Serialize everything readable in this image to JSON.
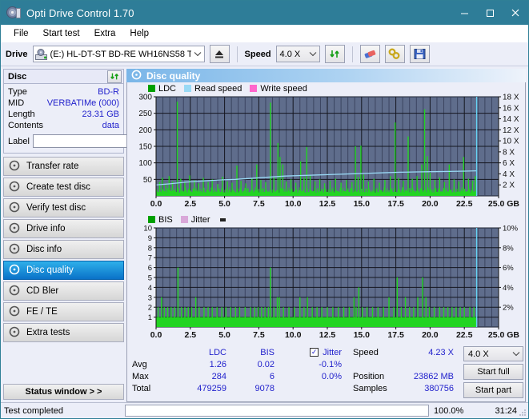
{
  "window": {
    "title": "Opti Drive Control 1.70",
    "icon": "disc-icon",
    "minimize": "─",
    "maximize": "□",
    "close": "✕"
  },
  "menu": {
    "items": [
      "File",
      "Start test",
      "Extra",
      "Help"
    ]
  },
  "toolbar": {
    "drive_label": "Drive",
    "drive_value": "(E:)  HL-DT-ST BD-RE  WH16NS58 TST4",
    "eject": "eject-icon",
    "speed_label": "Speed",
    "speed_value": "4.0 X",
    "refresh": "refresh-icon",
    "erase": "erase-icon",
    "tools": "tools-icon",
    "save": "save-icon"
  },
  "sidebar": {
    "disc_panel_title": "Disc",
    "disc_rows": [
      {
        "key": "Type",
        "value": "BD-R"
      },
      {
        "key": "MID",
        "value": "VERBATIMe (000)"
      },
      {
        "key": "Length",
        "value": "23.31 GB"
      },
      {
        "key": "Contents",
        "value": "data"
      }
    ],
    "label_key": "Label",
    "label_value": "",
    "nav": [
      {
        "label": "Transfer rate",
        "active": false
      },
      {
        "label": "Create test disc",
        "active": false
      },
      {
        "label": "Verify test disc",
        "active": false
      },
      {
        "label": "Drive info",
        "active": false
      },
      {
        "label": "Disc info",
        "active": false
      },
      {
        "label": "Disc quality",
        "active": true
      },
      {
        "label": "CD Bler",
        "active": false
      },
      {
        "label": "FE / TE",
        "active": false
      },
      {
        "label": "Extra tests",
        "active": false
      }
    ],
    "status_window_button": "Status window > >"
  },
  "content": {
    "header_title": "Disc quality",
    "header_icon": "disc-quality-icon"
  },
  "stats": {
    "col_headers": {
      "ldc": "LDC",
      "bis": "BIS",
      "jitter": "Jitter"
    },
    "jitter_checked": true,
    "rows": [
      {
        "label": "Avg",
        "ldc": "1.26",
        "bis": "0.02",
        "jitter": "-0.1%"
      },
      {
        "label": "Max",
        "ldc": "284",
        "bis": "6",
        "jitter": "0.0%"
      },
      {
        "label": "Total",
        "ldc": "479259",
        "bis": "9078",
        "jitter": ""
      }
    ],
    "speed_key": "Speed",
    "speed_value": "4.23 X",
    "position_key": "Position",
    "position_value": "23862 MB",
    "samples_key": "Samples",
    "samples_value": "380756",
    "speed_select": "4.0 X",
    "start_full": "Start full",
    "start_part": "Start part"
  },
  "statusbar": {
    "message": "Test completed",
    "percent_label": "100.0%",
    "percent_value": 100,
    "elapsed": "31:24"
  },
  "colors": {
    "titlebar": "#2e7d98",
    "accent_blue": "#2222cc",
    "plot_bg": "#5f6d8c",
    "grid": "#2b2f3d",
    "ldc_green": "#22d422",
    "read_speed": "#99d9f5",
    "write_speed": "#ff66cc",
    "jitter_pink": "#d9a8d9",
    "progress_green": "#00a824",
    "nav_active_top": "#2fb0ea",
    "nav_active_bottom": "#0a72c8"
  },
  "chart_data": [
    {
      "id": "ldc-chart",
      "type": "line",
      "title": "",
      "xlabel": "GB",
      "ylabel": "LDC",
      "xlim": [
        0,
        25
      ],
      "ylim": [
        0,
        300
      ],
      "y2lim": [
        0,
        18
      ],
      "y2label": "X",
      "xticks": [
        0.0,
        2.5,
        5.0,
        7.5,
        10.0,
        12.5,
        15.0,
        17.5,
        20.0,
        22.5,
        25.0
      ],
      "xticklabels": [
        "0.0",
        "2.5",
        "5.0",
        "7.5",
        "10.0",
        "12.5",
        "15.0",
        "17.5",
        "20.0",
        "22.5",
        "25.0 GB"
      ],
      "yticks": [
        50,
        100,
        150,
        200,
        250,
        300
      ],
      "y2ticks": [
        2,
        4,
        6,
        8,
        10,
        12,
        14,
        16,
        18
      ],
      "y2ticklabels": [
        "2 X",
        "4 X",
        "6 X",
        "8 X",
        "10 X",
        "12 X",
        "14 X",
        "16 X",
        "18 X"
      ],
      "grid": true,
      "legend": [
        "LDC",
        "Read speed",
        "Write speed"
      ],
      "legend_position": "top-left",
      "data_end_gb": 23.4,
      "series": [
        {
          "name": "LDC",
          "color": "#22d422",
          "baseline": 18,
          "spikes": [
            [
              0.25,
              42
            ],
            [
              0.45,
              55
            ],
            [
              0.7,
              38
            ],
            [
              0.95,
              60
            ],
            [
              1.2,
              44
            ],
            [
              1.55,
              285
            ],
            [
              1.8,
              52
            ],
            [
              2.1,
              40
            ],
            [
              2.45,
              62
            ],
            [
              2.8,
              48
            ],
            [
              3.1,
              38
            ],
            [
              3.45,
              55
            ],
            [
              3.8,
              42
            ],
            [
              4.1,
              50
            ],
            [
              4.5,
              36
            ],
            [
              4.85,
              58
            ],
            [
              5.2,
              44
            ],
            [
              5.55,
              40
            ],
            [
              5.9,
              92
            ],
            [
              6.2,
              46
            ],
            [
              6.55,
              38
            ],
            [
              7.0,
              52
            ],
            [
              7.35,
              95
            ],
            [
              7.65,
              48
            ],
            [
              8.0,
              42
            ],
            [
              8.35,
              282
            ],
            [
              8.6,
              58
            ],
            [
              8.9,
              160
            ],
            [
              9.05,
              118
            ],
            [
              9.25,
              95
            ],
            [
              9.5,
              44
            ],
            [
              9.85,
              50
            ],
            [
              10.2,
              40
            ],
            [
              10.55,
              105
            ],
            [
              10.8,
              56
            ],
            [
              11.0,
              148
            ],
            [
              11.25,
              62
            ],
            [
              11.6,
              44
            ],
            [
              11.95,
              50
            ],
            [
              12.3,
              38
            ],
            [
              12.7,
              46
            ],
            [
              13.1,
              52
            ],
            [
              13.5,
              40
            ],
            [
              13.9,
              48
            ],
            [
              14.3,
              42
            ],
            [
              14.55,
              150
            ],
            [
              14.75,
              58
            ],
            [
              14.95,
              152
            ],
            [
              15.15,
              64
            ],
            [
              15.5,
              44
            ],
            [
              15.9,
              52
            ],
            [
              16.3,
              40
            ],
            [
              16.7,
              48
            ],
            [
              17.1,
              60
            ],
            [
              17.45,
              222
            ],
            [
              17.7,
              54
            ],
            [
              18.05,
              46
            ],
            [
              18.4,
              180
            ],
            [
              18.7,
              52
            ],
            [
              19.05,
              60
            ],
            [
              19.4,
              95
            ],
            [
              19.6,
              262
            ],
            [
              19.8,
              120
            ],
            [
              20.0,
              70
            ],
            [
              20.35,
              48
            ],
            [
              20.7,
              56
            ],
            [
              21.05,
              42
            ],
            [
              21.4,
              95
            ],
            [
              21.75,
              50
            ],
            [
              22.1,
              44
            ],
            [
              22.45,
              118
            ],
            [
              22.8,
              52
            ],
            [
              23.1,
              46
            ],
            [
              23.3,
              60
            ]
          ]
        },
        {
          "name": "Read speed",
          "color": "#99d9f5",
          "unit": "X",
          "points": [
            [
              0.0,
              2.0
            ],
            [
              1.0,
              2.2
            ],
            [
              2.2,
              2.5
            ],
            [
              3.4,
              2.7
            ],
            [
              4.6,
              2.9
            ],
            [
              5.8,
              3.0
            ],
            [
              7.0,
              3.2
            ],
            [
              8.2,
              3.4
            ],
            [
              9.4,
              3.6
            ],
            [
              10.6,
              3.7
            ],
            [
              11.8,
              3.8
            ],
            [
              13.0,
              3.9
            ],
            [
              14.2,
              4.0
            ],
            [
              15.4,
              4.1
            ],
            [
              16.6,
              4.2
            ],
            [
              17.8,
              4.3
            ],
            [
              19.0,
              4.35
            ],
            [
              20.2,
              4.4
            ],
            [
              21.4,
              4.45
            ],
            [
              22.6,
              4.5
            ],
            [
              23.4,
              4.55
            ]
          ]
        },
        {
          "name": "Write speed",
          "color": "#ff66cc",
          "points": []
        }
      ],
      "end_marker": {
        "x": 23.4,
        "color": "#66d4f5"
      }
    },
    {
      "id": "bis-chart",
      "type": "bar",
      "title": "",
      "xlabel": "GB",
      "ylabel": "BIS",
      "xlim": [
        0,
        25
      ],
      "ylim": [
        0,
        10
      ],
      "y2lim": [
        0,
        10
      ],
      "y2label": "%",
      "xticks": [
        0.0,
        2.5,
        5.0,
        7.5,
        10.0,
        12.5,
        15.0,
        17.5,
        20.0,
        22.5,
        25.0
      ],
      "xticklabels": [
        "0.0",
        "2.5",
        "5.0",
        "7.5",
        "10.0",
        "12.5",
        "15.0",
        "17.5",
        "20.0",
        "22.5",
        "25.0 GB"
      ],
      "yticks": [
        1,
        2,
        3,
        4,
        5,
        6,
        7,
        8,
        9,
        10
      ],
      "y2ticks": [
        2,
        4,
        6,
        8,
        10
      ],
      "y2ticklabels": [
        "2%",
        "4%",
        "6%",
        "8%",
        "10%"
      ],
      "grid": true,
      "legend": [
        "BIS",
        "Jitter"
      ],
      "legend_position": "top-left",
      "data_end_gb": 23.4,
      "series": [
        {
          "name": "BIS",
          "color": "#22d422",
          "baseline": 1,
          "spikes": [
            [
              0.15,
              2
            ],
            [
              0.4,
              3
            ],
            [
              0.6,
              2
            ],
            [
              0.85,
              2
            ],
            [
              1.1,
              2
            ],
            [
              1.35,
              2
            ],
            [
              1.6,
              6
            ],
            [
              1.85,
              2
            ],
            [
              2.1,
              2
            ],
            [
              2.35,
              2
            ],
            [
              2.6,
              2
            ],
            [
              2.9,
              3
            ],
            [
              3.15,
              2
            ],
            [
              3.5,
              2
            ],
            [
              3.8,
              2
            ],
            [
              4.1,
              2
            ],
            [
              4.45,
              2
            ],
            [
              4.8,
              2
            ],
            [
              5.1,
              2
            ],
            [
              5.45,
              2
            ],
            [
              5.8,
              2
            ],
            [
              6.1,
              2
            ],
            [
              6.5,
              2
            ],
            [
              6.9,
              2
            ],
            [
              7.2,
              2
            ],
            [
              7.45,
              2
            ],
            [
              7.7,
              2
            ],
            [
              7.95,
              2
            ],
            [
              8.2,
              2
            ],
            [
              8.35,
              6
            ],
            [
              8.6,
              2
            ],
            [
              8.85,
              3
            ],
            [
              9.0,
              3
            ],
            [
              9.3,
              2
            ],
            [
              9.7,
              2
            ],
            [
              10.1,
              2
            ],
            [
              10.5,
              3
            ],
            [
              10.8,
              2
            ],
            [
              11.05,
              3
            ],
            [
              11.4,
              2
            ],
            [
              11.75,
              2
            ],
            [
              12.1,
              2
            ],
            [
              12.5,
              2
            ],
            [
              12.9,
              2
            ],
            [
              13.3,
              2
            ],
            [
              13.7,
              2
            ],
            [
              14.1,
              2
            ],
            [
              14.45,
              3
            ],
            [
              14.6,
              2
            ],
            [
              14.8,
              4
            ],
            [
              15.05,
              2
            ],
            [
              15.4,
              2
            ],
            [
              15.8,
              2
            ],
            [
              16.2,
              2
            ],
            [
              16.6,
              2
            ],
            [
              17.0,
              3
            ],
            [
              17.35,
              2
            ],
            [
              17.6,
              5
            ],
            [
              17.9,
              2
            ],
            [
              18.2,
              3
            ],
            [
              18.5,
              2
            ],
            [
              18.8,
              2
            ],
            [
              19.1,
              3
            ],
            [
              19.45,
              5
            ],
            [
              19.7,
              3
            ],
            [
              19.95,
              2
            ],
            [
              20.3,
              2
            ],
            [
              20.7,
              2
            ],
            [
              21.0,
              2
            ],
            [
              21.3,
              2
            ],
            [
              21.6,
              2
            ],
            [
              21.9,
              2
            ],
            [
              22.2,
              2
            ],
            [
              22.5,
              2
            ],
            [
              22.9,
              2
            ],
            [
              23.2,
              2
            ]
          ]
        },
        {
          "name": "Jitter",
          "color": "#d9a8d9",
          "points": []
        }
      ],
      "end_marker": {
        "x": 23.4,
        "color": "#66d4f5"
      }
    }
  ]
}
